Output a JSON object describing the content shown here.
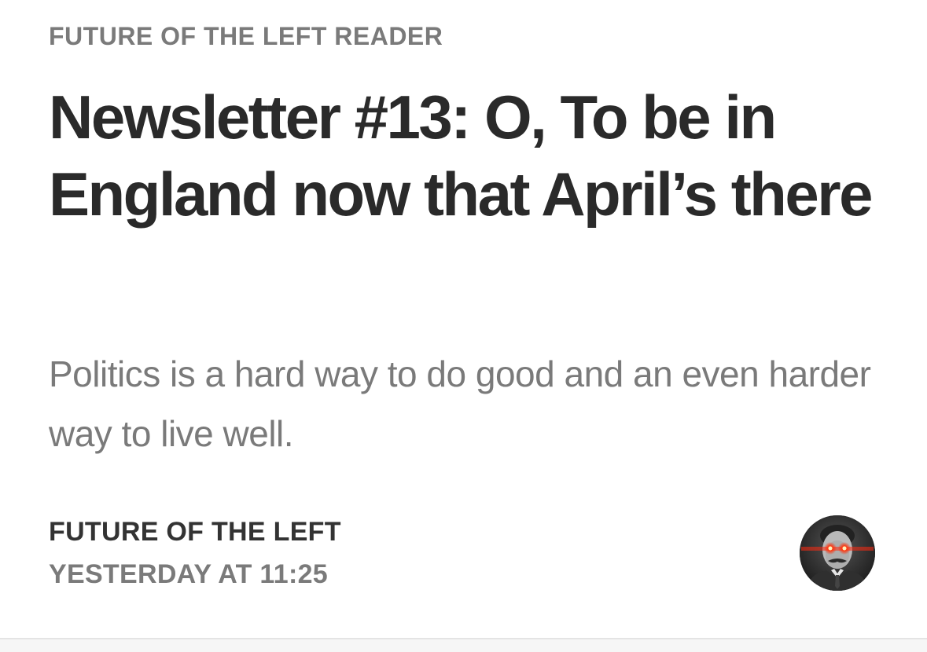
{
  "article": {
    "publication": "FUTURE OF THE LEFT READER",
    "title": "Newsletter #13: O, To be in England now that April’s there",
    "subtitle": "Politics is a hard way to do good and an even harder way to live well.",
    "author": "FUTURE OF THE LEFT",
    "date": "YESTERDAY AT 11:25",
    "avatar_icon": "author-portrait-laser-eyes-icon"
  },
  "colors": {
    "title": "#2a2a2a",
    "muted": "#7a7a7a",
    "author": "#333333",
    "laser": "#ff2a10"
  }
}
